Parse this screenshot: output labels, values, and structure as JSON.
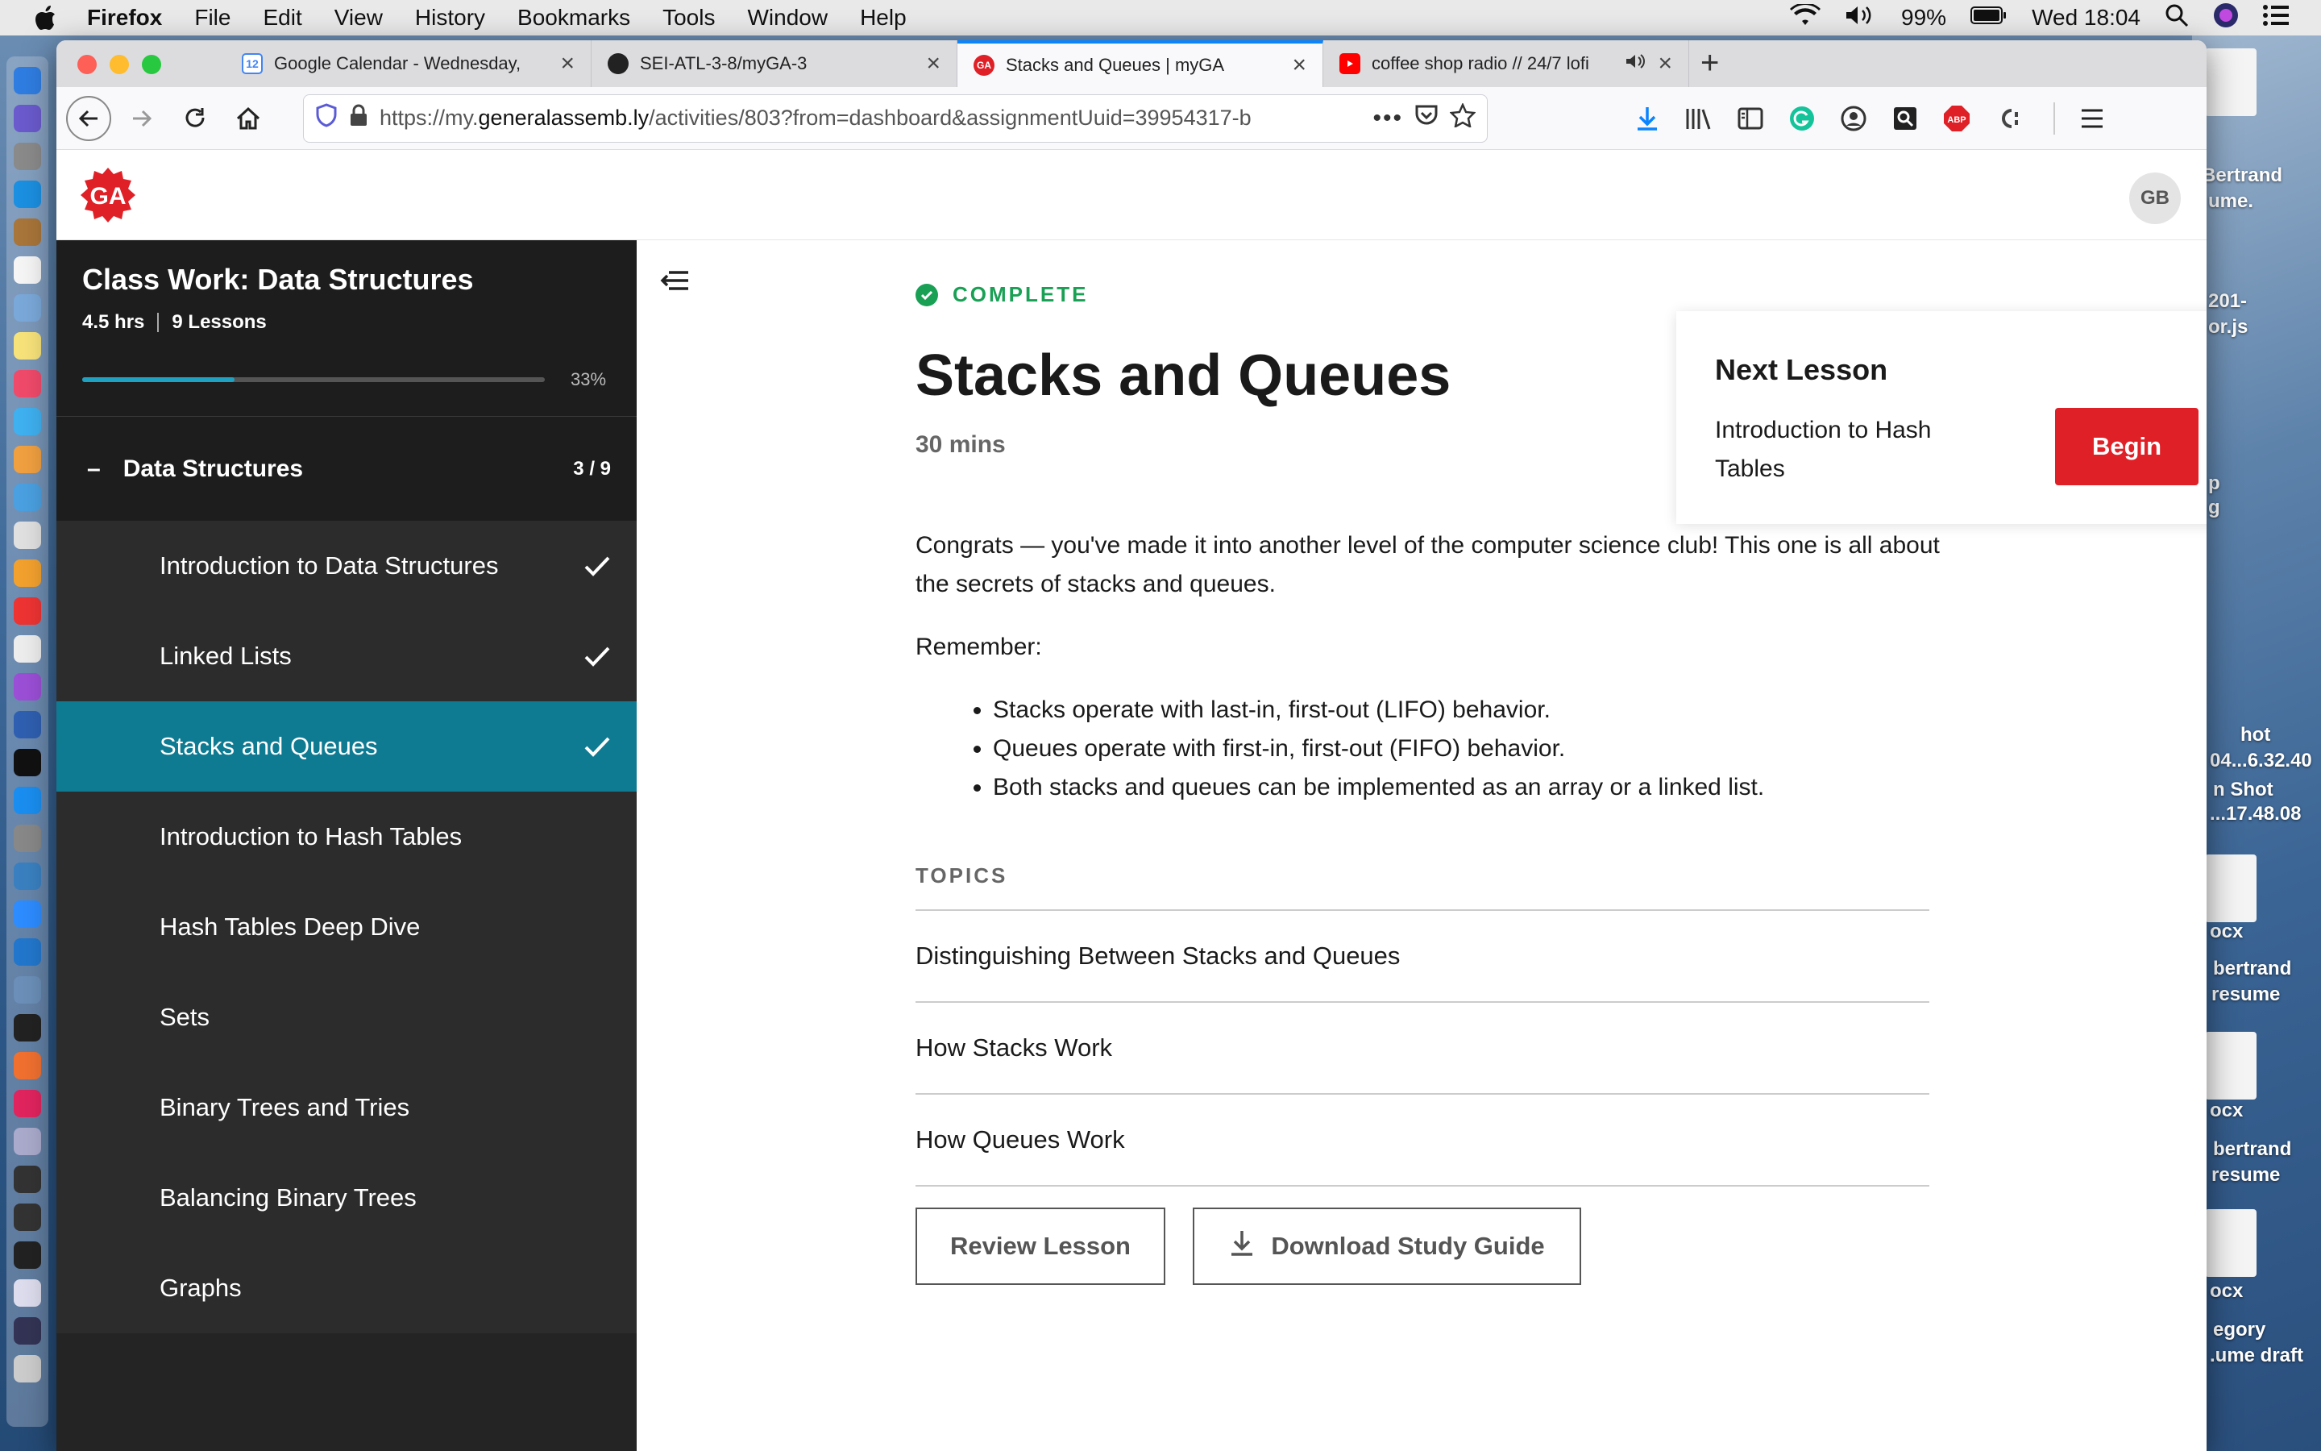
{
  "menubar": {
    "app": "Firefox",
    "items": [
      "File",
      "Edit",
      "View",
      "History",
      "Bookmarks",
      "Tools",
      "Window",
      "Help"
    ],
    "battery": "99%",
    "clock": "Wed 18:04"
  },
  "browser": {
    "tabs": [
      {
        "label": "Google Calendar - Wednesday,",
        "icon": "calendar-icon"
      },
      {
        "label": "SEI-ATL-3-8/myGA-3",
        "icon": "github-icon"
      },
      {
        "label": "Stacks and Queues | myGA",
        "icon": "ga-icon"
      },
      {
        "label": "coffee shop radio // 24/7 lofi",
        "icon": "youtube-icon"
      }
    ],
    "url_prefix": "https://my.",
    "url_host": "generalassemb.ly",
    "url_rest": "/activities/803?from=dashboard&assignmentUuid=39954317-b"
  },
  "site": {
    "avatar": "GB"
  },
  "sidebar": {
    "title": "Class Work: Data Structures",
    "hours": "4.5 hrs",
    "lessons": "9 Lessons",
    "progress_pct": 33,
    "progress_label": "33%",
    "section": {
      "label": "Data Structures",
      "count": "3 / 9"
    },
    "items": [
      {
        "label": "Introduction to Data Structures",
        "done": true
      },
      {
        "label": "Linked Lists",
        "done": true
      },
      {
        "label": "Stacks and Queues",
        "done": true
      },
      {
        "label": "Introduction to Hash Tables",
        "done": false
      },
      {
        "label": "Hash Tables Deep Dive",
        "done": false
      },
      {
        "label": "Sets",
        "done": false
      },
      {
        "label": "Binary Trees and Tries",
        "done": false
      },
      {
        "label": "Balancing Binary Trees",
        "done": false
      },
      {
        "label": "Graphs",
        "done": false
      }
    ]
  },
  "lesson": {
    "status": "COMPLETE",
    "title": "Stacks and Queues",
    "duration": "30 mins",
    "intro": "Congrats — you've made it into another level of the computer science club! This one is all about the secrets of stacks and queues.",
    "remember": "Remember:",
    "bullets": [
      "Stacks operate with last-in, first-out (LIFO) behavior.",
      "Queues operate with first-in, first-out (FIFO) behavior.",
      "Both stacks and queues can be implemented as an array or a linked list."
    ],
    "topics_heading": "TOPICS",
    "topics": [
      "Distinguishing Between Stacks and Queues",
      "How Stacks Work",
      "How Queues Work"
    ],
    "review_button": "Review Lesson",
    "download_button": "Download Study Guide"
  },
  "next_lesson": {
    "heading": "Next Lesson",
    "title": "Introduction to Hash Tables",
    "button": "Begin"
  },
  "desktop": {
    "labels": [
      "Bertrand",
      "ume.",
      "201-",
      "or.js",
      "p",
      "g",
      "hot",
      "04...6.32.40",
      "n Shot",
      "...17.48.08",
      "ocx",
      "bertrand",
      "resume",
      "ocx",
      "bertrand",
      "resume",
      "ocx",
      "egory",
      ".ume draft"
    ]
  },
  "colors": {
    "accent_teal": "#0f7b93",
    "complete_green": "#1aa055",
    "begin_red": "#e02027",
    "ga_red": "#e02027"
  }
}
